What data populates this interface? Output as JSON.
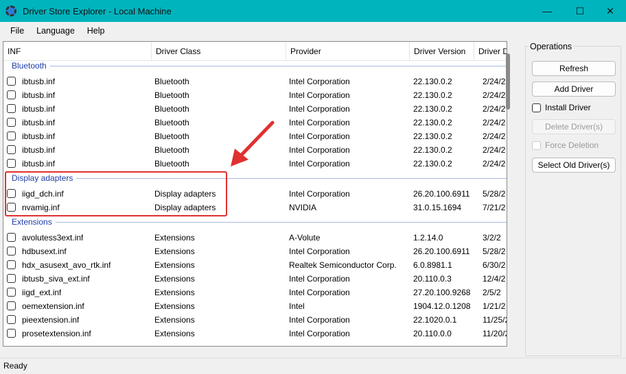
{
  "window": {
    "title": "Driver Store Explorer - Local Machine"
  },
  "menu": [
    "File",
    "Language",
    "Help"
  ],
  "columns": [
    "INF",
    "Driver Class",
    "Provider",
    "Driver Version",
    "Driver D"
  ],
  "groups": [
    {
      "name": "Bluetooth",
      "rows": [
        [
          "ibtusb.inf",
          "Bluetooth",
          "Intel Corporation",
          "22.130.0.2",
          "2/24/2"
        ],
        [
          "ibtusb.inf",
          "Bluetooth",
          "Intel Corporation",
          "22.130.0.2",
          "2/24/2"
        ],
        [
          "ibtusb.inf",
          "Bluetooth",
          "Intel Corporation",
          "22.130.0.2",
          "2/24/2"
        ],
        [
          "ibtusb.inf",
          "Bluetooth",
          "Intel Corporation",
          "22.130.0.2",
          "2/24/2"
        ],
        [
          "ibtusb.inf",
          "Bluetooth",
          "Intel Corporation",
          "22.130.0.2",
          "2/24/2"
        ],
        [
          "ibtusb.inf",
          "Bluetooth",
          "Intel Corporation",
          "22.130.0.2",
          "2/24/2"
        ],
        [
          "ibtusb.inf",
          "Bluetooth",
          "Intel Corporation",
          "22.130.0.2",
          "2/24/2"
        ]
      ]
    },
    {
      "name": "Display adapters",
      "rows": [
        [
          "iigd_dch.inf",
          "Display adapters",
          "Intel Corporation",
          "26.20.100.6911",
          "5/28/2"
        ],
        [
          "nvamig.inf",
          "Display adapters",
          "NVIDIA",
          "31.0.15.1694",
          "7/21/2"
        ]
      ]
    },
    {
      "name": "Extensions",
      "rows": [
        [
          "avolutess3ext.inf",
          "Extensions",
          "A-Volute",
          "1.2.14.0",
          "3/2/2"
        ],
        [
          "hdbusext.inf",
          "Extensions",
          "Intel Corporation",
          "26.20.100.6911",
          "5/28/2"
        ],
        [
          "hdx_asusext_avo_rtk.inf",
          "Extensions",
          "Realtek Semiconductor Corp.",
          "6.0.8981.1",
          "6/30/2"
        ],
        [
          "ibtusb_siva_ext.inf",
          "Extensions",
          "Intel Corporation",
          "20.110.0.3",
          "12/4/2"
        ],
        [
          "iigd_ext.inf",
          "Extensions",
          "Intel Corporation",
          "27.20.100.9268",
          "2/5/2"
        ],
        [
          "oemextension.inf",
          "Extensions",
          "Intel",
          "1904.12.0.1208",
          "1/21/2"
        ],
        [
          "pieextension.inf",
          "Extensions",
          "Intel Corporation",
          "22.1020.0.1",
          "11/25/2"
        ],
        [
          "prosetextension.inf",
          "Extensions",
          "Intel Corporation",
          "20.110.0.0",
          "11/20/2"
        ]
      ]
    }
  ],
  "operations": {
    "label": "Operations",
    "refresh": "Refresh",
    "add_driver": "Add Driver",
    "install_driver": "Install Driver",
    "delete_driver": "Delete Driver(s)",
    "force_deletion": "Force Deletion",
    "select_old": "Select Old Driver(s)"
  },
  "status": "Ready",
  "colors": {
    "titlebar": "#00b4be",
    "group_text": "#1e3da8",
    "highlight": "#e03030"
  }
}
